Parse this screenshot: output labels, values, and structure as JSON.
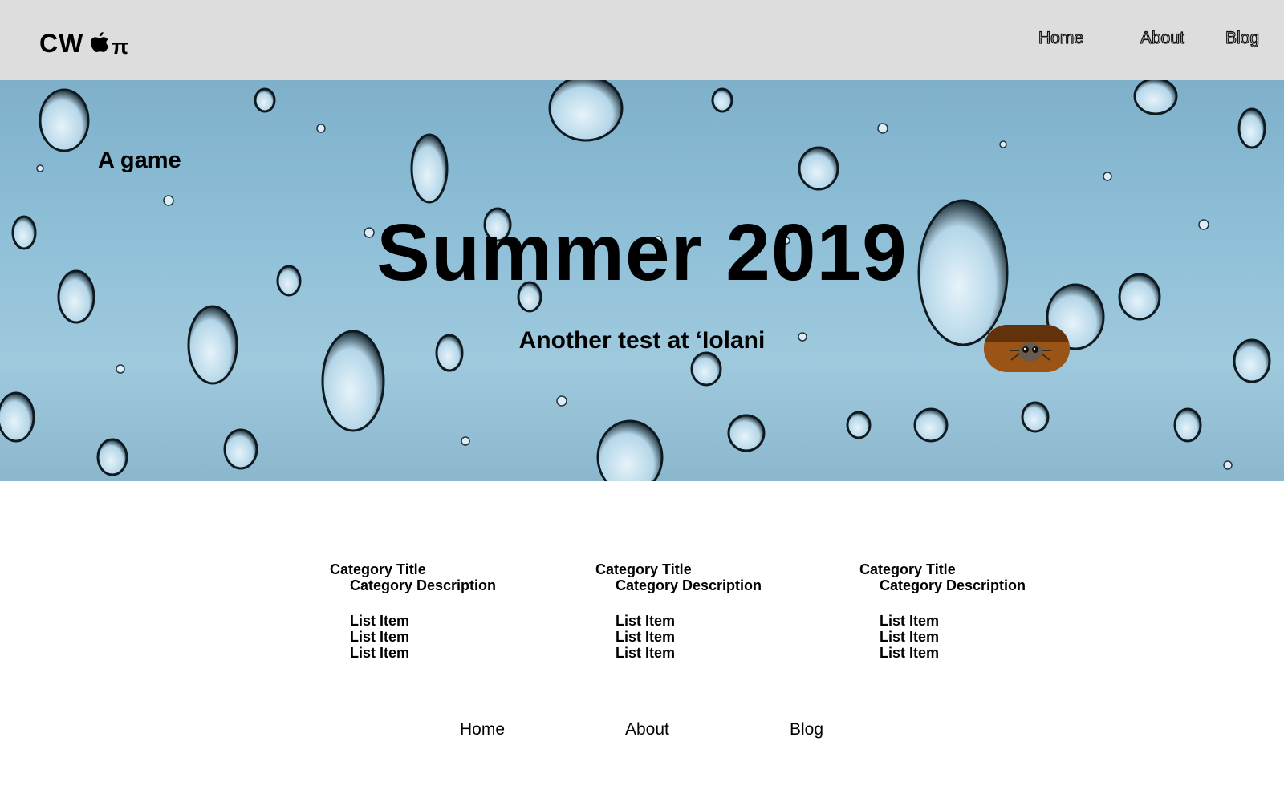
{
  "header": {
    "logo_text": "CW",
    "logo_icon": "apple-icon",
    "logo_suffix": "π",
    "nav": [
      {
        "label": "Home"
      },
      {
        "label": "About"
      },
      {
        "label": "Blog"
      }
    ]
  },
  "hero": {
    "tag": "A game",
    "title": "Summer 2019",
    "subtitle": "Another test at ʻIolani",
    "pill_image": "spider-photo"
  },
  "categories": [
    {
      "title": "Category Title",
      "description": "Category Description",
      "items": [
        "List Item",
        "List Item",
        "List Item"
      ]
    },
    {
      "title": "Category Title",
      "description": "Category Description",
      "items": [
        "List Item",
        "List Item",
        "List Item"
      ]
    },
    {
      "title": "Category Title",
      "description": "Category Description",
      "items": [
        "List Item",
        "List Item",
        "List Item"
      ]
    }
  ],
  "footer": {
    "nav": [
      {
        "label": "Home"
      },
      {
        "label": "About"
      },
      {
        "label": "Blog"
      }
    ]
  },
  "colors": {
    "header_bg": "#dddddd",
    "hero_bg": "#8fc0d8",
    "page_bg": "#ffffff",
    "text": "#000000"
  }
}
